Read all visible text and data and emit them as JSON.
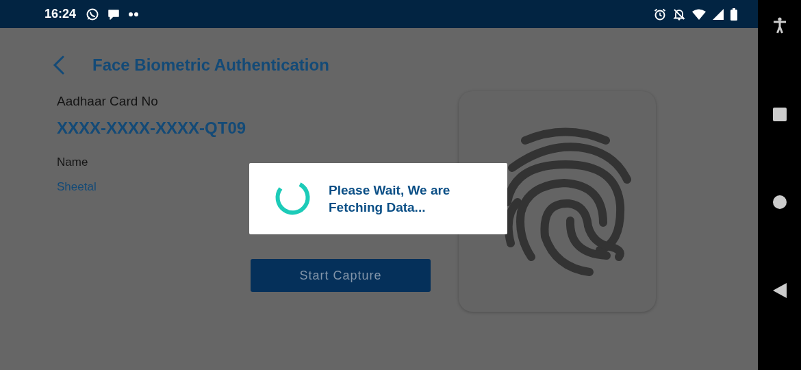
{
  "status_bar": {
    "time": "16:24"
  },
  "header": {
    "title": "Face Biometric Authentication"
  },
  "fields": [
    {
      "label": "Aadhaar Card No",
      "value": "XXXX-XXXX-XXXX-QT09",
      "kind": "large"
    },
    {
      "label": "Name",
      "value": "Sheetal",
      "kind": "small"
    }
  ],
  "capture_button": {
    "label": "Start Capture",
    "disabled": true
  },
  "dialog": {
    "message": "Please Wait, We are Fetching Data..."
  }
}
